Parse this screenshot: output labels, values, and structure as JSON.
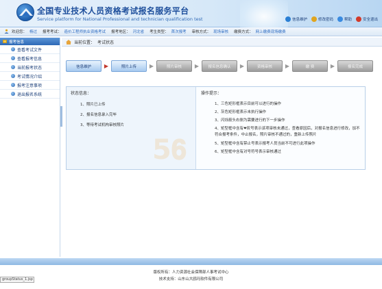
{
  "header": {
    "title": "全国专业技术人员资格考试报名服务平台",
    "subtitle": "Service platform for National Professional and technician qualification test",
    "links": [
      {
        "label": "信息维护",
        "icon": "info-icon",
        "color": "#2a7fd4"
      },
      {
        "label": "修改密码",
        "icon": "key-icon",
        "color": "#e0a51f"
      },
      {
        "label": "帮助",
        "icon": "help-icon",
        "color": "#3a8be0"
      },
      {
        "label": "安全退出",
        "icon": "exit-icon",
        "color": "#d23a2a"
      }
    ]
  },
  "infobar": {
    "welcome_label": "欢迎您：",
    "welcome_value": "杨过",
    "exam_label": "报考考试：",
    "exam_value": "造价工程师执业资格考试",
    "region_label": "报考地区：",
    "region_value": "河北省",
    "type_label": "考生类型：",
    "type_value": "首次报考",
    "review_label": "审核方式：",
    "review_value": "现场审核",
    "pay_label": "缴费方式：",
    "pay_value": "网上缴费现场缴费"
  },
  "sidebar": {
    "header": "报考信息",
    "items": [
      {
        "label": "查看考试文件"
      },
      {
        "label": "查看报考信息"
      },
      {
        "label": "当前报考状态"
      },
      {
        "label": "考试情况介绍"
      },
      {
        "label": "报考注意事项"
      },
      {
        "label": "退出报名系统"
      }
    ]
  },
  "breadcrumb": {
    "label": "当前位置：",
    "value": "考试状态"
  },
  "steps": [
    {
      "label": "信息维护",
      "state": "done"
    },
    {
      "label": "照片上传",
      "state": "done"
    },
    {
      "label": "照片审核",
      "state": "todo"
    },
    {
      "label": "报名信息确认",
      "state": "todo"
    },
    {
      "label": "资格审核",
      "state": "todo"
    },
    {
      "label": "缴 费",
      "state": "todo"
    },
    {
      "label": "报名完成",
      "state": "todo"
    }
  ],
  "status_panel": {
    "title": "状态信息：",
    "items": [
      "1、照片已上传",
      "2、报名信息录入完毕",
      "3、等待考试机构审核照片"
    ]
  },
  "tips_panel": {
    "title": "操作提示：",
    "items": [
      "1、三色矩形框表示目前可以进行的操作",
      "2、灰色矩形框表示未执行操作",
      "3、闪烁箭头右侧为需要进行的下一步操作",
      "4、矩型框中含有❤叹号表示该项审核未通过，查看原因后，对报名信息进行修改，加不符合报考条件，中止报名，照片审核不通过的，重新上传照片",
      "5、矩型框中含有禁止号表示报考人员当前不可进行此项操作",
      "6、矩型框中含有对号符号表示审核通过"
    ]
  },
  "footer": {
    "copyright": "版权所有：人力资源社会保障部人事考试中心",
    "support": "技术支持：山东山大鸥玛软件有限公司"
  },
  "status_bar": "groupStatus_1.jsp",
  "watermark": "5𝟔"
}
